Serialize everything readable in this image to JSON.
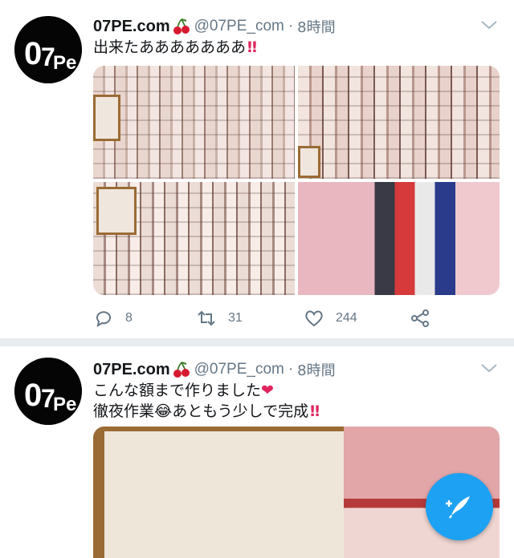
{
  "tweets": [
    {
      "name": "07PE.com",
      "handle": "@07PE_com",
      "separator": "·",
      "time": "8時間",
      "text": "出来たあああああああ",
      "bangs": "‼",
      "avatar_text": "07Pe",
      "replies": "8",
      "retweets": "31",
      "likes": "244"
    },
    {
      "name": "07PE.com",
      "handle": "@07PE_com",
      "separator": "·",
      "time": "8時間",
      "line1": "こんな額まで作りました",
      "heart": "❤",
      "line2_a": "徹夜作業",
      "emoji": "😂",
      "line2_b": "あともう少しで完成",
      "bangs": "‼",
      "avatar_text": "07Pe"
    }
  ],
  "colors": {
    "accent": "#1da1f2",
    "like": "#e0245e",
    "muted": "#657786",
    "text": "#14171a"
  },
  "icons": [
    "cherry-icon",
    "chevron-down-icon",
    "reply-icon",
    "retweet-icon",
    "like-icon",
    "share-icon",
    "compose-icon"
  ]
}
